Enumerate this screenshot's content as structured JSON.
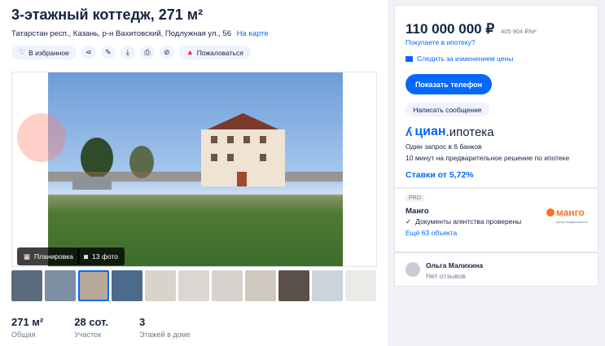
{
  "listing": {
    "title": "3-этажный коттедж, 271 м²",
    "address": "Татарстан респ., Казань, р-н Вахитовский, Подлужная ул., 56",
    "map_link": "На карте"
  },
  "actions": {
    "favorite_label": "В избранное",
    "report_label": "Пожаловаться"
  },
  "gallery": {
    "plan_label": "Планировка",
    "photo_count": "13 фото",
    "thumb_colors": [
      "#5b6a7c",
      "#7d8ea3",
      "#b7a99a",
      "#4b6a8c",
      "#d8d4cc",
      "#dad7d0",
      "#d6d3cc",
      "#cfc9bf",
      "#5a5048",
      "#c9d4dc",
      "#eceae6"
    ]
  },
  "stats": [
    {
      "value": "271 м²",
      "label": "Общая"
    },
    {
      "value": "28 сот.",
      "label": "Участок"
    },
    {
      "value": "3",
      "label": "Этажей в доме"
    }
  ],
  "price": {
    "value": "110 000 000 ₽",
    "per_meter": "405 904 ₽/м²",
    "mortgage_question": "Покупаете в ипотеку?",
    "follow_price": "Следить за изменением цены",
    "show_phone": "Показать телефон",
    "write_message": "Написать сообщение"
  },
  "mortgage": {
    "brand_logo": "циан",
    "brand_suffix": ".ипотека",
    "line1": "Один запрос в 6 банков",
    "line2": "10 минут на предварительное решение по ипотеке",
    "rate": "Ставки от 5,72%"
  },
  "agency": {
    "pro_badge": "PRO",
    "name": "Манго",
    "verified": "Документы агентства проверены",
    "more_objects": "Ещё 63 объекта",
    "logo_text": "манго",
    "logo_sub": "центр недвижимости"
  },
  "agent": {
    "name": "Ольга Малихина",
    "reviews": "Нет отзывов"
  },
  "colors": {
    "accent": "#0468ff",
    "text": "#152242",
    "muted": "#737a8e",
    "danger": "#ff1f34",
    "mango": "#ff6f22"
  }
}
